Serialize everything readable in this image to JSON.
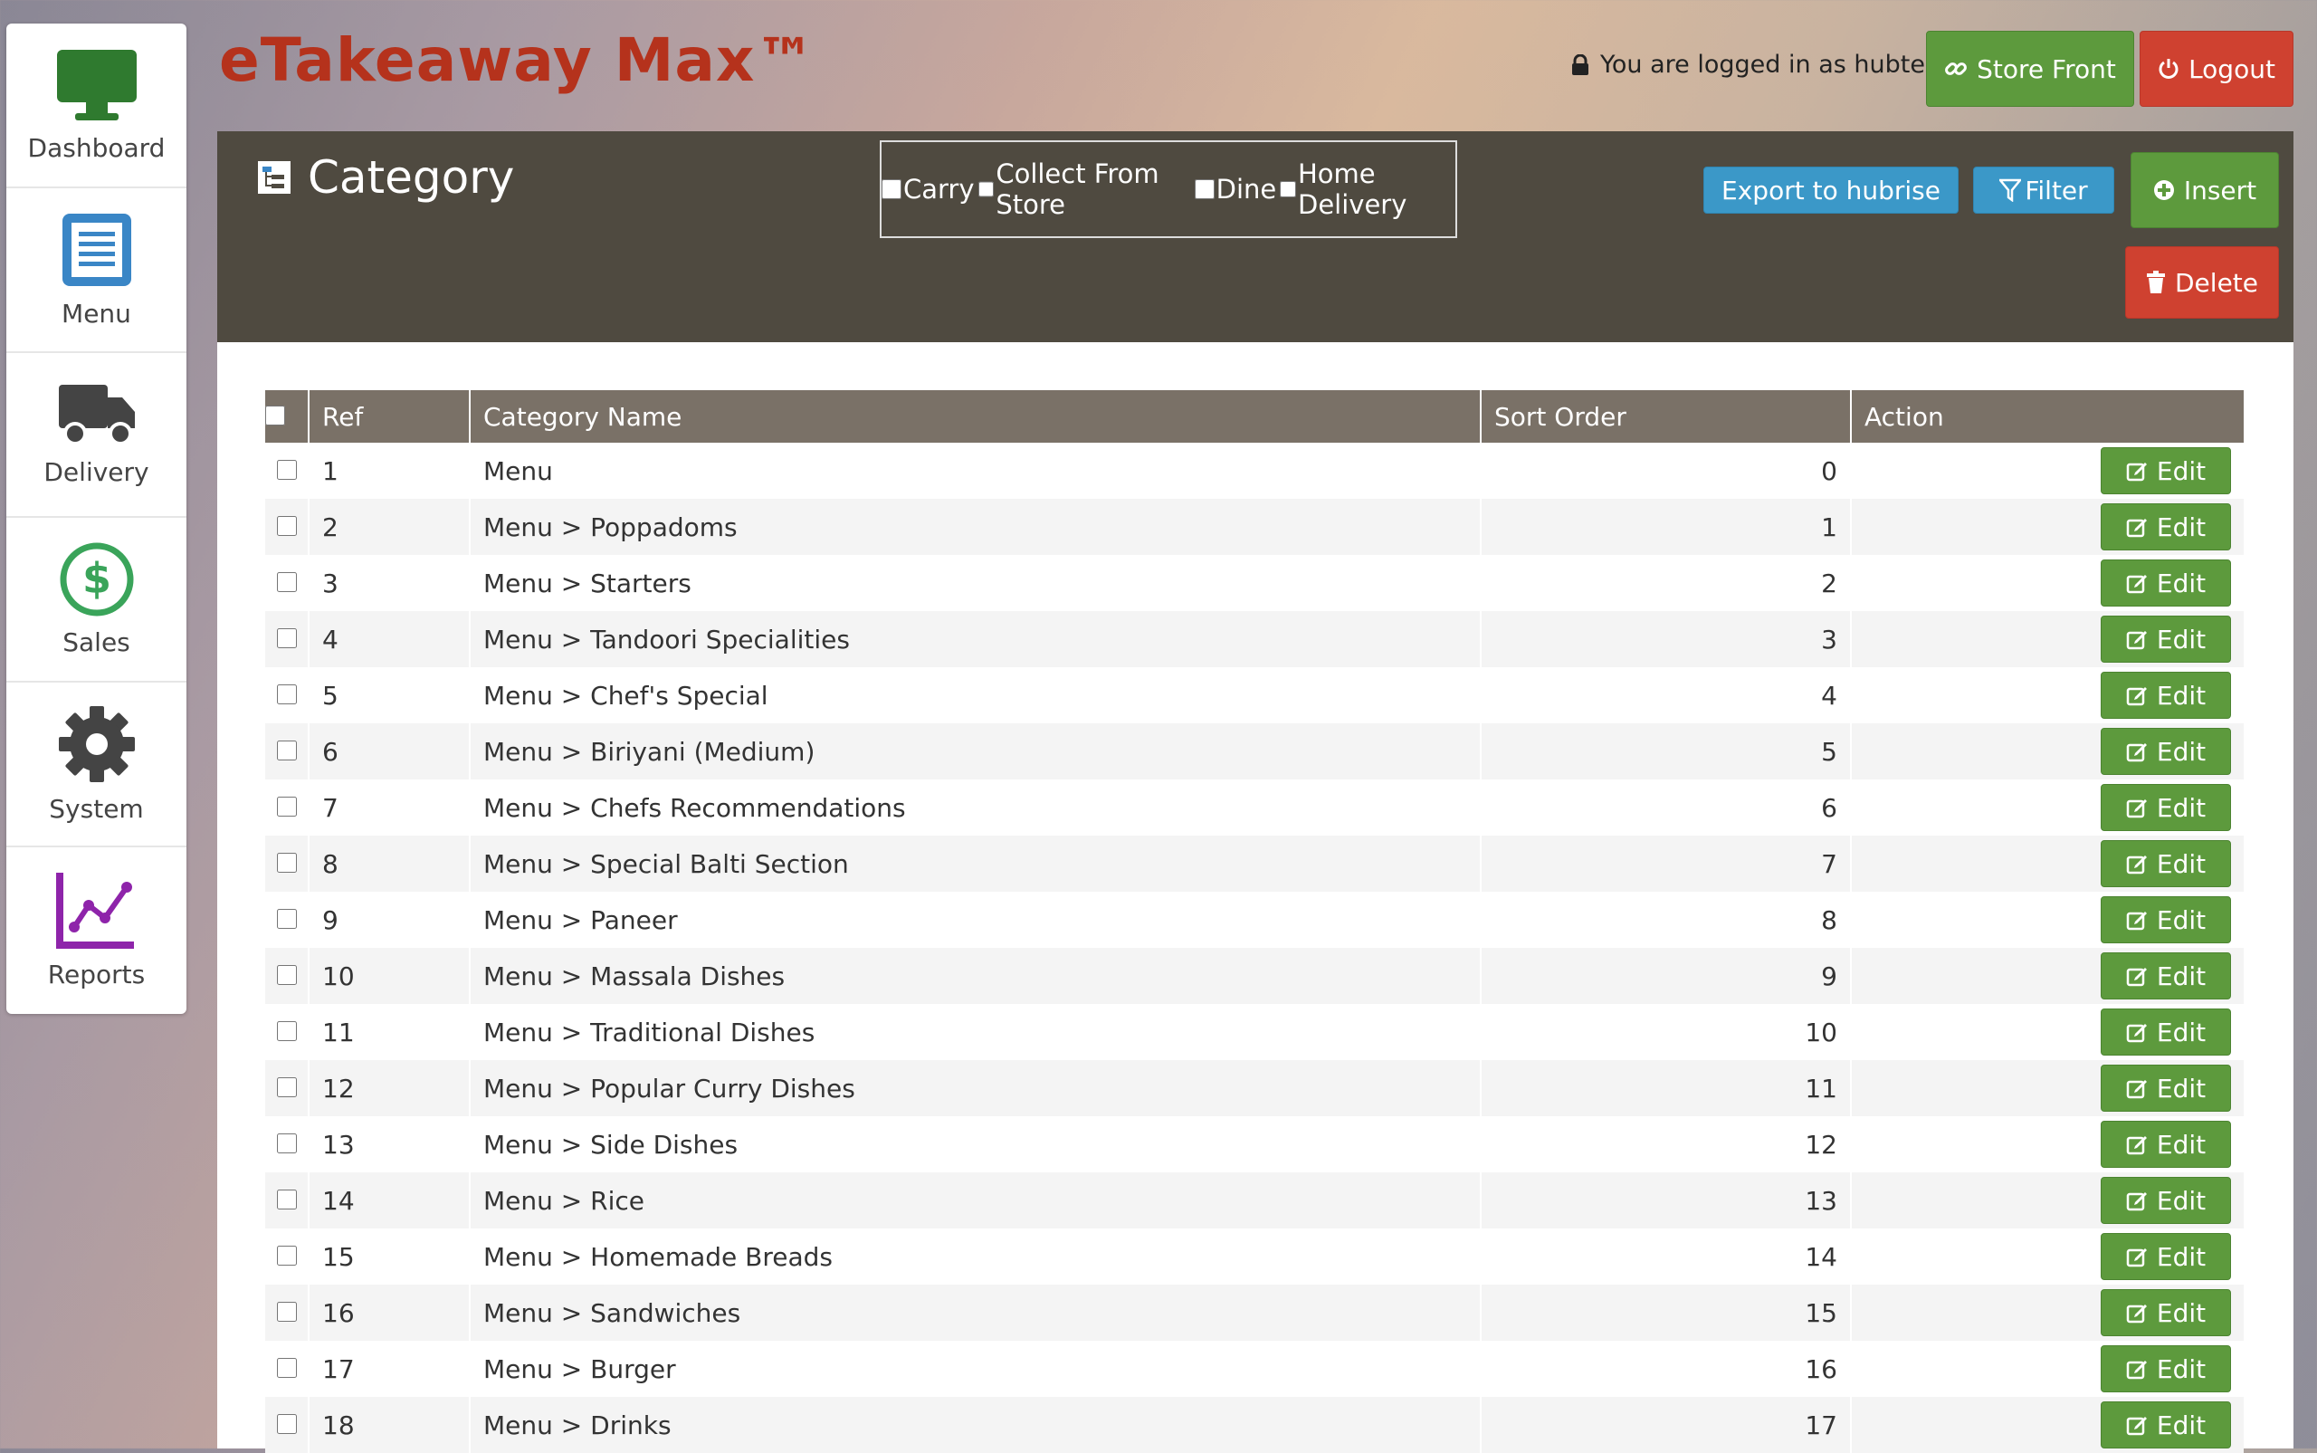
{
  "app": {
    "brand": "eTakeaway Max™",
    "login_text": "You are logged in as hubtest",
    "store_front_label": "Store Front",
    "logout_label": "Logout"
  },
  "sidebar": {
    "items": [
      {
        "label": "Dashboard",
        "icon": "monitor-icon",
        "color": "#2f7a2f"
      },
      {
        "label": "Menu",
        "icon": "menu-doc-icon",
        "color": "#3a86c6"
      },
      {
        "label": "Delivery",
        "icon": "truck-icon",
        "color": "#444444"
      },
      {
        "label": "Sales",
        "icon": "dollar-icon",
        "color": "#3aa45a"
      },
      {
        "label": "System",
        "icon": "gear-icon",
        "color": "#444444"
      },
      {
        "label": "Reports",
        "icon": "chart-icon",
        "color": "#8e24aa"
      }
    ]
  },
  "panel": {
    "title": "Category",
    "modes": [
      {
        "label": "Carry",
        "checked": false
      },
      {
        "label": "Collect From Store",
        "checked": false
      },
      {
        "label": "Dine",
        "checked": false
      },
      {
        "label": "Home Delivery",
        "checked": false
      }
    ],
    "export_label": "Export to hubrise",
    "filter_label": "Filter",
    "insert_label": "Insert",
    "delete_label": "Delete"
  },
  "table": {
    "headers": {
      "ref": "Ref",
      "name": "Category Name",
      "sort": "Sort Order",
      "action": "Action"
    },
    "edit_label": "Edit",
    "rows": [
      {
        "ref": "1",
        "name": "Menu",
        "sort": "0"
      },
      {
        "ref": "2",
        "name": "Menu > Poppadoms",
        "sort": "1"
      },
      {
        "ref": "3",
        "name": "Menu > Starters",
        "sort": "2"
      },
      {
        "ref": "4",
        "name": "Menu > Tandoori Specialities",
        "sort": "3"
      },
      {
        "ref": "5",
        "name": "Menu > Chef's Special",
        "sort": "4"
      },
      {
        "ref": "6",
        "name": "Menu > Biriyani (Medium)",
        "sort": "5"
      },
      {
        "ref": "7",
        "name": "Menu > Chefs Recommendations",
        "sort": "6"
      },
      {
        "ref": "8",
        "name": "Menu > Special Balti Section",
        "sort": "7"
      },
      {
        "ref": "9",
        "name": "Menu > Paneer",
        "sort": "8"
      },
      {
        "ref": "10",
        "name": "Menu > Massala Dishes",
        "sort": "9"
      },
      {
        "ref": "11",
        "name": "Menu > Traditional Dishes",
        "sort": "10"
      },
      {
        "ref": "12",
        "name": "Menu > Popular Curry Dishes",
        "sort": "11"
      },
      {
        "ref": "13",
        "name": "Menu > Side Dishes",
        "sort": "12"
      },
      {
        "ref": "14",
        "name": "Menu > Rice",
        "sort": "13"
      },
      {
        "ref": "15",
        "name": "Menu > Homemade Breads",
        "sort": "14"
      },
      {
        "ref": "16",
        "name": "Menu > Sandwiches",
        "sort": "15"
      },
      {
        "ref": "17",
        "name": "Menu > Burger",
        "sort": "16"
      },
      {
        "ref": "18",
        "name": "Menu > Drinks",
        "sort": "17"
      }
    ]
  }
}
